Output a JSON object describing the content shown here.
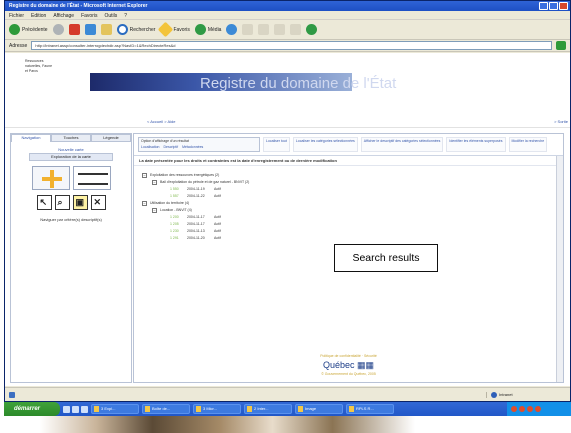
{
  "window": {
    "title": "Registre du domaine de l'État - Microsoft Internet Explorer",
    "menu": [
      "Fichier",
      "Edition",
      "Affichage",
      "Favoris",
      "Outils",
      "?"
    ]
  },
  "toolbar": {
    "back_label": "Précédente",
    "search_label": "Rechercher",
    "favorites_label": "Favoris",
    "media_label": "Média"
  },
  "address": {
    "label": "Adresse",
    "value": "http://intranet.assp/consulter-interrogdechdir.asp?NavID=1&RechDirecteRes&d"
  },
  "banner": {
    "title": "Registre du domaine de l'État",
    "logo_text": "Ressources naturelles, Faune et Parcs",
    "breadcrumb": "< Accueil > Aide",
    "right_link": "> Sortie"
  },
  "left_panel": {
    "tabs": [
      "Navigation",
      "Touches",
      "Légende"
    ],
    "heading": "Nouvelle carte",
    "sub_heading": "Exploration de la carte",
    "link": "Naviguer par critère(s) descriptif(s)",
    "tools": [
      "pan-tool",
      "zoom-extent-tool",
      "select-tool",
      "info-tool",
      "identify-tool",
      "clear-tool"
    ]
  },
  "main_panel": {
    "options_title": "Option d'affichage d'un résultat",
    "radio_options": [
      "Localisation",
      "Descriptif",
      "Métadonnées"
    ],
    "links": [
      "Localiser tout",
      "Localiser les catégories sélectionnées",
      "Afficher le descriptif des catégories sélectionnées",
      "Identifier les éléments superposés",
      "Modifier la recherche"
    ],
    "notice": "La date présentée pour les droits et contraintes est la date d'enregistrement ou de dernière modification",
    "tree": [
      {
        "level": 1,
        "label": "Exploitation des ressources énergétiques (2)"
      },
      {
        "level": 2,
        "label": "Bail d'exploitation du pétrole et de gaz naturel - BNVIT (2)"
      },
      {
        "level": 3,
        "code": "1 550",
        "date": "2004-11-19",
        "status": "Actif"
      },
      {
        "level": 3,
        "code": "1 557",
        "date": "2004-11-22",
        "status": "Actif"
      },
      {
        "level": 1,
        "label": "Utilisation du territoire (4)"
      },
      {
        "level": 2,
        "label": "Location - BNVIT (4)"
      },
      {
        "level": 3,
        "code": "1 200",
        "date": "2004-11-17",
        "status": "Actif"
      },
      {
        "level": 3,
        "code": "1 205",
        "date": "2004-11-17",
        "status": "Actif"
      },
      {
        "level": 3,
        "code": "1 230",
        "date": "2004-11-13",
        "status": "Actif"
      },
      {
        "level": 3,
        "code": "1 291",
        "date": "2004-11-20",
        "status": "Actif"
      }
    ],
    "annotation": "Search results"
  },
  "footer": {
    "top_text": "Politique de confidentialité · Sécurité",
    "logo": "Québec",
    "logo_flag": "▦▦",
    "bottom_text": "© Gouvernement du Québec, 2005"
  },
  "statusbar": {
    "left_text": "",
    "zone": "Intranet"
  },
  "taskbar": {
    "start_label": "démarrer",
    "tasks": [
      "3 Expl...",
      "Boîte de...",
      "3 Micr...",
      "2 Inter...",
      "Image",
      "RPLS R..."
    ]
  },
  "colors": {
    "titlebar": "#1d4fc4",
    "link": "#3355aa",
    "tree_code": "#7ab648",
    "footer_gold": "#c9a533",
    "start_green": "#2c8a2a"
  }
}
